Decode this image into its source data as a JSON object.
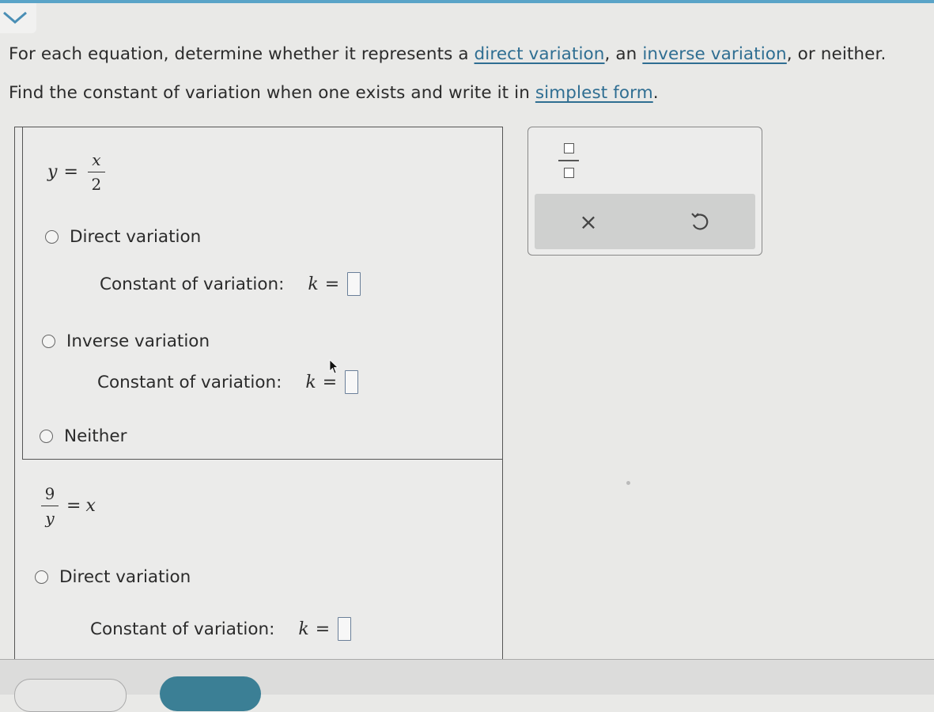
{
  "instructions": {
    "line1_pre": "For each equation, determine whether it represents a ",
    "link_direct": "direct variation",
    "line1_mid": ", an ",
    "link_inverse": "inverse variation",
    "line1_post": ", or neither.",
    "line2_pre": "Find the constant of variation when one exists and write it in ",
    "link_simplest": "simplest form",
    "line2_post": "."
  },
  "problem1": {
    "equation": {
      "lhs": "y",
      "eq": "=",
      "num": "x",
      "den": "2"
    },
    "option_direct": "Direct variation",
    "const_label_1": "Constant of variation:",
    "k1": "k",
    "eq1": "=",
    "option_inverse": "Inverse variation",
    "const_label_2": "Constant of variation:",
    "k2": "k",
    "eq2": "=",
    "option_neither": "Neither"
  },
  "problem2": {
    "equation": {
      "num": "9",
      "den": "y",
      "eq": "=",
      "rhs": "x"
    },
    "option_direct": "Direct variation",
    "const_label_1": "Constant of variation:",
    "k1": "k",
    "eq1": "="
  },
  "toolbox": {
    "clear_symbol": "×",
    "undo_icon": "undo-icon"
  },
  "colors": {
    "link": "#2f6e92",
    "accent": "#3b7f95"
  }
}
